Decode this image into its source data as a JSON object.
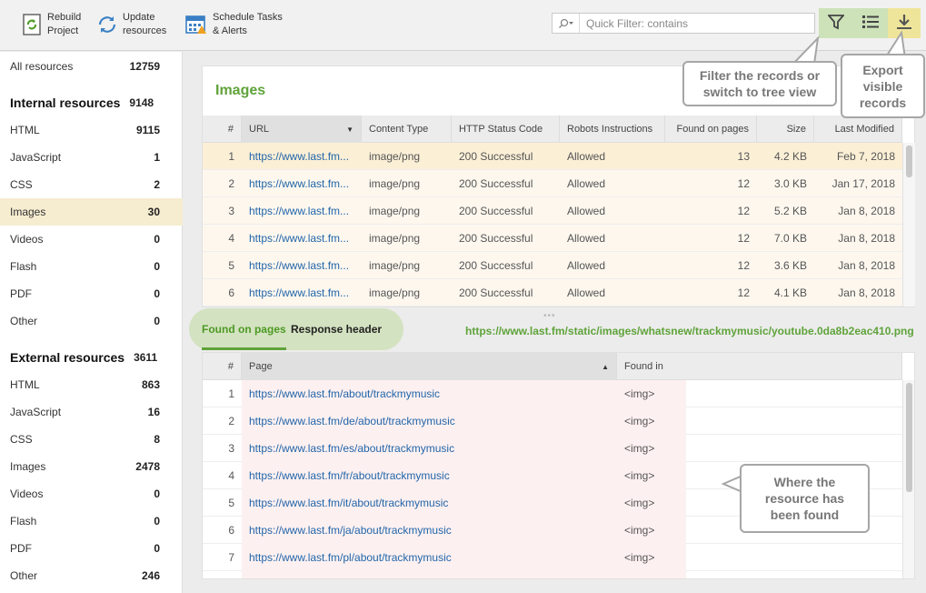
{
  "toolbar": {
    "rebuild": {
      "line1": "Rebuild",
      "line2": "Project"
    },
    "update": {
      "line1": "Update",
      "line2": "resources"
    },
    "schedule": {
      "line1": "Schedule Tasks",
      "line2": "& Alerts"
    },
    "search_placeholder": "Quick Filter: contains"
  },
  "sidebar": {
    "all": {
      "label": "All resources",
      "count": "12759"
    },
    "internal": {
      "title": "Internal resources",
      "count": "9148",
      "items": [
        {
          "label": "HTML",
          "count": "9115"
        },
        {
          "label": "JavaScript",
          "count": "1"
        },
        {
          "label": "CSS",
          "count": "2"
        },
        {
          "label": "Images",
          "count": "30"
        },
        {
          "label": "Videos",
          "count": "0"
        },
        {
          "label": "Flash",
          "count": "0"
        },
        {
          "label": "PDF",
          "count": "0"
        },
        {
          "label": "Other",
          "count": "0"
        }
      ]
    },
    "external": {
      "title": "External resources",
      "count": "3611",
      "items": [
        {
          "label": "HTML",
          "count": "863"
        },
        {
          "label": "JavaScript",
          "count": "16"
        },
        {
          "label": "CSS",
          "count": "8"
        },
        {
          "label": "Images",
          "count": "2478"
        },
        {
          "label": "Videos",
          "count": "0"
        },
        {
          "label": "Flash",
          "count": "0"
        },
        {
          "label": "PDF",
          "count": "0"
        },
        {
          "label": "Other",
          "count": "246"
        }
      ]
    }
  },
  "main": {
    "title": "Images",
    "columns": [
      "#",
      "URL",
      "Content Type",
      "HTTP Status Code",
      "Robots Instructions",
      "Found on pages",
      "Size",
      "Last Modified"
    ],
    "rows": [
      {
        "n": "1",
        "url": "https://www.last.fm...",
        "type": "image/png",
        "status": "200 Successful",
        "robots": "Allowed",
        "found": "13",
        "size": "4.2 KB",
        "modified": "Feb 7, 2018"
      },
      {
        "n": "2",
        "url": "https://www.last.fm...",
        "type": "image/png",
        "status": "200 Successful",
        "robots": "Allowed",
        "found": "12",
        "size": "3.0 KB",
        "modified": "Jan 17, 2018"
      },
      {
        "n": "3",
        "url": "https://www.last.fm...",
        "type": "image/png",
        "status": "200 Successful",
        "robots": "Allowed",
        "found": "12",
        "size": "5.2 KB",
        "modified": "Jan 8, 2018"
      },
      {
        "n": "4",
        "url": "https://www.last.fm...",
        "type": "image/png",
        "status": "200 Successful",
        "robots": "Allowed",
        "found": "12",
        "size": "7.0 KB",
        "modified": "Jan 8, 2018"
      },
      {
        "n": "5",
        "url": "https://www.last.fm...",
        "type": "image/png",
        "status": "200 Successful",
        "robots": "Allowed",
        "found": "12",
        "size": "3.6 KB",
        "modified": "Jan 8, 2018"
      },
      {
        "n": "6",
        "url": "https://www.last.fm...",
        "type": "image/png",
        "status": "200 Successful",
        "robots": "Allowed",
        "found": "12",
        "size": "4.1 KB",
        "modified": "Jan 8, 2018"
      }
    ]
  },
  "tabs": [
    "Found on pages",
    "Response header"
  ],
  "selected_url": "https://www.last.fm/static/images/whatsnew/trackmymusic/youtube.0da8b2eac410.png",
  "found": {
    "columns": [
      "#",
      "Page",
      "Found in"
    ],
    "rows": [
      {
        "n": "1",
        "page": "https://www.last.fm/about/trackmymusic",
        "in": "<img>"
      },
      {
        "n": "2",
        "page": "https://www.last.fm/de/about/trackmymusic",
        "in": "<img>"
      },
      {
        "n": "3",
        "page": "https://www.last.fm/es/about/trackmymusic",
        "in": "<img>"
      },
      {
        "n": "4",
        "page": "https://www.last.fm/fr/about/trackmymusic",
        "in": "<img>"
      },
      {
        "n": "5",
        "page": "https://www.last.fm/it/about/trackmymusic",
        "in": "<img>"
      },
      {
        "n": "6",
        "page": "https://www.last.fm/ja/about/trackmymusic",
        "in": "<img>"
      },
      {
        "n": "7",
        "page": "https://www.last.fm/pl/about/trackmymusic",
        "in": "<img>"
      }
    ]
  },
  "callouts": {
    "filter": [
      "Filter the records or",
      "switch to tree view"
    ],
    "export": [
      "Export",
      "visible",
      "records"
    ],
    "where": [
      "Where the",
      "resource has",
      "been found"
    ]
  },
  "colors": {
    "accent_green": "#5fa33a",
    "selected_row": "#fbefd6",
    "filter_bg": "#cde2b9",
    "export_bg": "#efe59a"
  },
  "icons": [
    "rebuild-icon",
    "update-icon",
    "schedule-icon",
    "search-icon",
    "filter-icon",
    "tree-view-icon",
    "download-icon"
  ]
}
